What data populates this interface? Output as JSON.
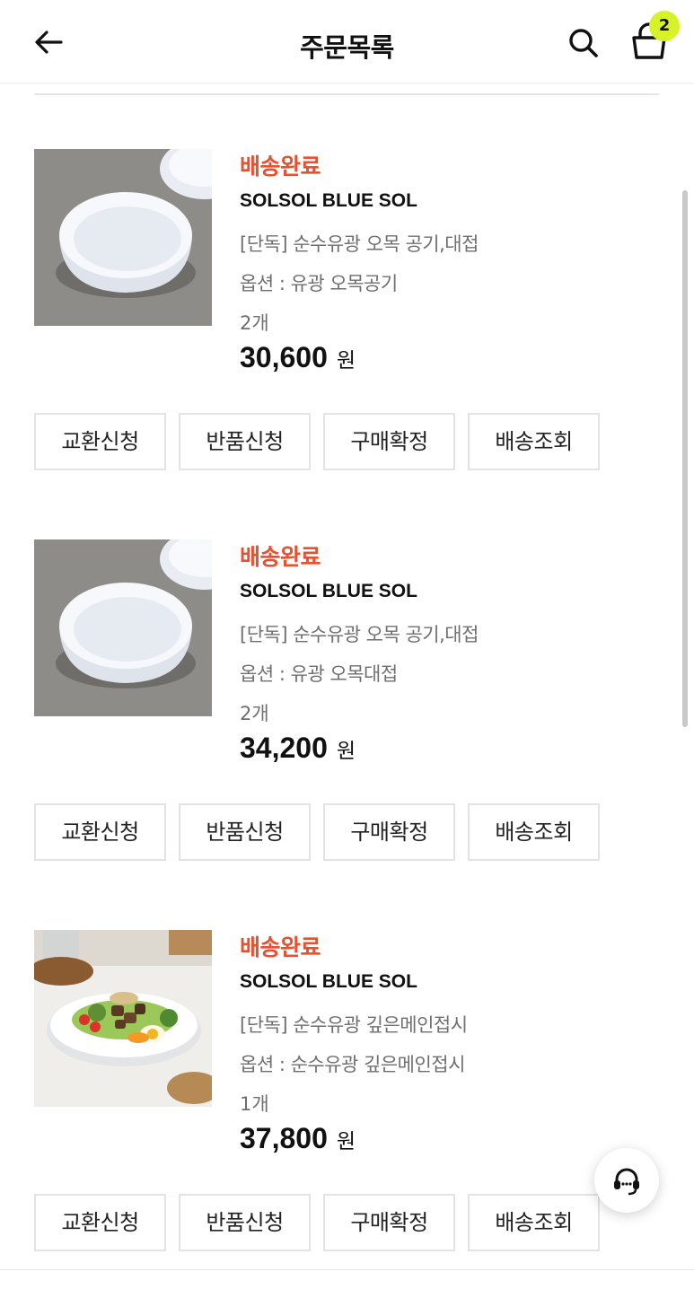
{
  "header": {
    "title": "주문목록",
    "cart_count": "2",
    "back_icon": "arrow-left-icon",
    "search_icon": "search-icon",
    "cart_icon": "shopping-bag-icon"
  },
  "colors": {
    "status": "#e8502f",
    "badge": "#d8f22a",
    "border": "#e3e3e3"
  },
  "orders": [
    {
      "status": "배송완료",
      "brand": "SOLSOL BLUE SOL",
      "product_name": "[단독] 순수유광 오목 공기,대접",
      "option": "옵션 : 유광 오목공기",
      "quantity": "2개",
      "price": "30,600",
      "currency": "원",
      "image": "white-bowl-photo",
      "buttons": [
        "교환신청",
        "반품신청",
        "구매확정",
        "배송조회"
      ]
    },
    {
      "status": "배송완료",
      "brand": "SOLSOL BLUE SOL",
      "product_name": "[단독] 순수유광 오목 공기,대접",
      "option": "옵션 : 유광 오목대접",
      "quantity": "2개",
      "price": "34,200",
      "currency": "원",
      "image": "white-bowl-photo",
      "buttons": [
        "교환신청",
        "반품신청",
        "구매확정",
        "배송조회"
      ]
    },
    {
      "status": "배송완료",
      "brand": "SOLSOL BLUE SOL",
      "product_name": "[단독] 순수유광 깊은메인접시",
      "option": "옵션 : 순수유광 깊은메인접시",
      "quantity": "1개",
      "price": "37,800",
      "currency": "원",
      "image": "salad-plate-photo",
      "buttons": [
        "교환신청",
        "반품신청",
        "구매확정",
        "배송조회"
      ]
    }
  ],
  "floating": {
    "support_icon": "headset-icon"
  }
}
